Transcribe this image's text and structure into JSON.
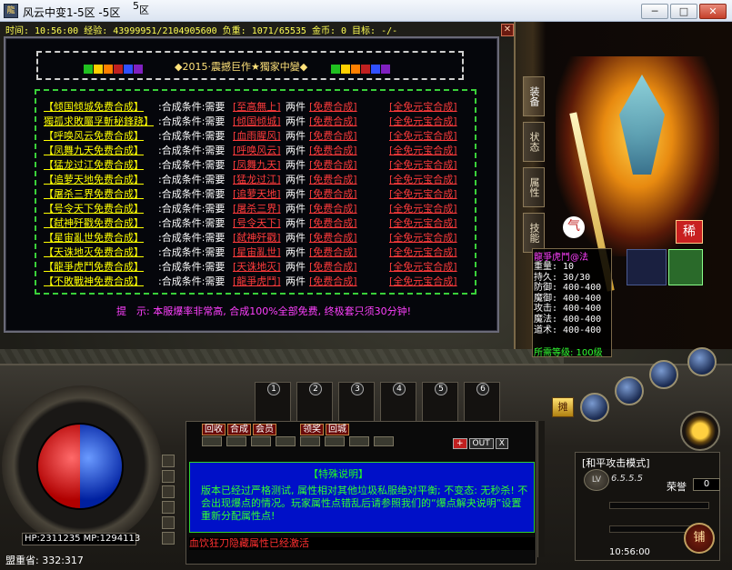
{
  "window": {
    "title": "风云中变1-5区 -5区",
    "title_suffix": "区",
    "title_super": "5",
    "controls": {
      "minimize": "─",
      "maximize": "□",
      "close": "✕"
    }
  },
  "status_line": "时间: 10:56:00 经验: 43999951/2104905600 负重: 1071/65535 金币: 0 目标: -/-",
  "dialog": {
    "close": "✕",
    "banner": "◆2015·震撼巨作★獨家中變◆",
    "banner_colors": [
      "#20c020",
      "#ffd000",
      "#ff8000",
      "#c02020",
      "#3050ff",
      "#8020c0"
    ],
    "rows": [
      {
        "item": "【倾国倾城免费合成】",
        "cond": ":合成条件:需要",
        "need": "[至高無上]",
        "count": "两件",
        "free": "[免费合成]",
        "gem": "[全免元宝合成]"
      },
      {
        "item": "獨孤求敗屬孚斬秘鋒跷】",
        "cond": ":合成条件:需要",
        "need": "[倾国倾城]",
        "count": "两件",
        "free": "[免费合成]",
        "gem": "[全免元宝合成]"
      },
      {
        "item": "【呼唤风云免费合成】",
        "cond": ":合成条件:需要",
        "need": "[血雨腥风]",
        "count": "两件",
        "free": "[免费合成]",
        "gem": "[全免元宝合成]"
      },
      {
        "item": "【凤舞九天免费合成】",
        "cond": ":合成条件:需要",
        "need": "[呼唤风云]",
        "count": "两件",
        "free": "[免费合成]",
        "gem": "[全免元宝合成]"
      },
      {
        "item": "【猛龙过江免费合成】",
        "cond": ":合成条件:需要",
        "need": "[凤舞九天]",
        "count": "两件",
        "free": "[免费合成]",
        "gem": "[全免元宝合成]"
      },
      {
        "item": "【追萝天地免费合成】",
        "cond": ":合成条件:需要",
        "need": "[猛龙过江]",
        "count": "两件",
        "free": "[免费合成]",
        "gem": "[全免元宝合成]"
      },
      {
        "item": "【屠杀三界免费合成】",
        "cond": ":合成条件:需要",
        "need": "[追萝天地]",
        "count": "两件",
        "free": "[免费合成]",
        "gem": "[全免元宝合成]"
      },
      {
        "item": "【号令天下免费合成】",
        "cond": ":合成条件:需要",
        "need": "[屠杀三界]",
        "count": "两件",
        "free": "[免费合成]",
        "gem": "[全免元宝合成]"
      },
      {
        "item": "【弑神歼戳免费合成】",
        "cond": ":合成条件:需要",
        "need": "[号令天下]",
        "count": "两件",
        "free": "[免费合成]",
        "gem": "[全免元宝合成]"
      },
      {
        "item": "【星宙亂世免费合成】",
        "cond": ":合成条件:需要",
        "need": "[弑神歼戳]",
        "count": "两件",
        "free": "[免费合成]",
        "gem": "[全免元宝合成]"
      },
      {
        "item": "【天诛地灭免费合成】",
        "cond": ":合成条件:需要",
        "need": "[星宙亂世]",
        "count": "两件",
        "free": "[免费合成]",
        "gem": "[全免元宝合成]"
      },
      {
        "item": "【龍爭虎鬥免费合成】",
        "cond": ":合成条件:需要",
        "need": "[天诛地灭]",
        "count": "两件",
        "free": "[免费合成]",
        "gem": "[全免元宝合成]"
      },
      {
        "item": "【不敗戰神免费合成】",
        "cond": ":合成条件:需要",
        "need": "[龍爭虎鬥]",
        "count": "两件",
        "free": "[免费合成]",
        "gem": "[全免元宝合成]"
      }
    ],
    "tip": "提　示: 本服爆率非常高, 合成100%全部免费, 终极套只须30分钟!"
  },
  "character_panel": {
    "tabs": [
      "装备",
      "状态",
      "属性",
      "技能"
    ],
    "badge_left": "气",
    "badge_right": "稀",
    "item_name": "龍爭虎鬥@法",
    "stats": [
      "重量: 10",
      "持久: 30/30",
      "防御: 400-400",
      "魔御: 400-400",
      "攻击: 400-400",
      "魔法: 400-400",
      "道术: 400-400"
    ],
    "footer": "所需等级: 100级"
  },
  "hud": {
    "hp_mp": "HP:2311235 MP:1294113",
    "map": "盟重省: 332:317",
    "belt_slots": [
      "1",
      "2",
      "3",
      "4",
      "5",
      "6"
    ],
    "sell_button": "摊",
    "attack_mode": "[和平攻击模式]",
    "level_label": "LV",
    "level_value": "6.5.5.5",
    "honor_label": "荣誉",
    "honor_value": "0",
    "clock": "10:56:00",
    "shop_button": "铺"
  },
  "chat": {
    "tabs": [
      "回收",
      "合成",
      "会员",
      "领奖",
      "回城"
    ],
    "controls": [
      "+",
      "OUT",
      "X"
    ],
    "notice_title": "【特殊说明】",
    "notice_body": "版本已经过严格测试, 属性相对其他垃圾私服绝对平衡; 不变态: 无秒杀! 不会出现爆点的情况。玩家属性点错乱后请参照我们的“爆点解夬说明”设置重新分配属性点!",
    "input_text": "血饮狂刀隐藏属性已经激活"
  }
}
